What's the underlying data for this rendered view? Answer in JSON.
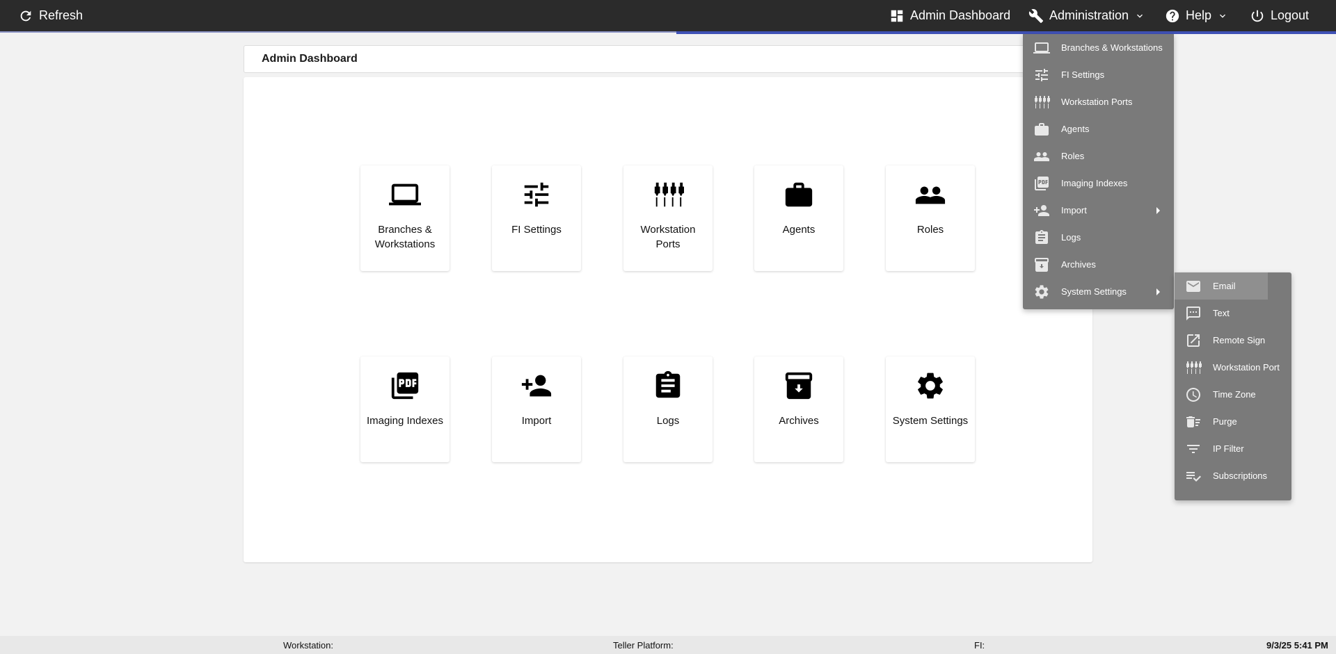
{
  "topbar": {
    "refresh_label": "Refresh",
    "admin_dashboard_label": "Admin Dashboard",
    "administration_label": "Administration",
    "help_label": "Help",
    "logout_label": "Logout"
  },
  "page": {
    "title": "Admin Dashboard"
  },
  "tiles": [
    {
      "label": "Branches & Workstations",
      "icon": "laptop-icon"
    },
    {
      "label": "FI Settings",
      "icon": "tune-icon"
    },
    {
      "label": "Workstation Ports",
      "icon": "ports-icon"
    },
    {
      "label": "Agents",
      "icon": "briefcase-icon"
    },
    {
      "label": "Roles",
      "icon": "people-icon"
    },
    {
      "label": "Imaging Indexes",
      "icon": "pdf-icon"
    },
    {
      "label": "Import",
      "icon": "person-add-icon"
    },
    {
      "label": "Logs",
      "icon": "clipboard-icon"
    },
    {
      "label": "Archives",
      "icon": "archive-icon"
    },
    {
      "label": "System Settings",
      "icon": "gear-icon"
    }
  ],
  "admin_menu": [
    {
      "label": "Branches & Workstations",
      "icon": "laptop-icon"
    },
    {
      "label": "FI Settings",
      "icon": "tune-icon"
    },
    {
      "label": "Workstation Ports",
      "icon": "ports-icon"
    },
    {
      "label": "Agents",
      "icon": "briefcase-icon"
    },
    {
      "label": "Roles",
      "icon": "people-icon"
    },
    {
      "label": "Imaging Indexes",
      "icon": "pdf-icon"
    },
    {
      "label": "Import",
      "icon": "person-add-icon",
      "submenu": true
    },
    {
      "label": "Logs",
      "icon": "clipboard-icon"
    },
    {
      "label": "Archives",
      "icon": "archive-icon"
    },
    {
      "label": "System Settings",
      "icon": "gear-icon",
      "submenu": true
    }
  ],
  "system_settings_menu": [
    {
      "label": "Email",
      "icon": "mail-icon",
      "highlighted": true
    },
    {
      "label": "Text",
      "icon": "sms-icon"
    },
    {
      "label": "Remote Sign",
      "icon": "open-external-icon"
    },
    {
      "label": "Workstation Port",
      "icon": "ports-icon"
    },
    {
      "label": "Time Zone",
      "icon": "clock-icon"
    },
    {
      "label": "Purge",
      "icon": "delete-sweep-icon"
    },
    {
      "label": "IP Filter",
      "icon": "filter-icon"
    },
    {
      "label": "Subscriptions",
      "icon": "playlist-check-icon"
    }
  ],
  "footer": {
    "workstation_label": "Workstation:",
    "teller_platform_label": "Teller Platform:",
    "fi_label": "FI:",
    "datetime": "9/3/25 5:41 PM"
  },
  "colors": {
    "topbar_bg": "#2b2b2b",
    "accent": "#3f51b5",
    "menu_bg": "#7a7a7a"
  }
}
